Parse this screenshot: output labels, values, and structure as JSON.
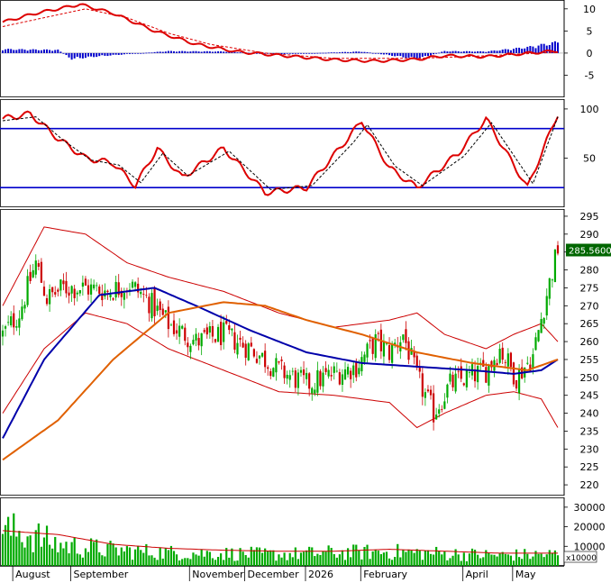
{
  "chart_data": [
    {
      "type": "line",
      "panel": "macd",
      "ylim": [
        -10,
        12
      ],
      "yticks": [
        "10",
        "5",
        "0",
        "-5"
      ],
      "ytick_values": [
        10,
        5,
        0,
        -5
      ],
      "x_count": 202,
      "series": [
        {
          "role": "macd",
          "color": "#dd0000",
          "style": "solid",
          "points": [
            [
              0,
              7
            ],
            [
              12,
              9
            ],
            [
              28,
              11
            ],
            [
              40,
              9
            ],
            [
              55,
              5
            ],
            [
              70,
              2
            ],
            [
              85,
              0.3
            ],
            [
              100,
              -0.5
            ],
            [
              110,
              -1
            ],
            [
              120,
              -1.5
            ],
            [
              135,
              -1.8
            ],
            [
              150,
              -1.4
            ],
            [
              160,
              -0.6
            ],
            [
              175,
              -0.8
            ],
            [
              185,
              -0.3
            ],
            [
              201,
              0.5
            ]
          ]
        },
        {
          "role": "signal",
          "color": "#dd0000",
          "style": "dashed",
          "points": [
            [
              0,
              6
            ],
            [
              15,
              8
            ],
            [
              30,
              10
            ],
            [
              45,
              8
            ],
            [
              60,
              4.5
            ],
            [
              75,
              2
            ],
            [
              95,
              0
            ],
            [
              120,
              -1.2
            ],
            [
              150,
              -1.2
            ],
            [
              175,
              -0.6
            ],
            [
              201,
              0.2
            ]
          ]
        },
        {
          "role": "histogram",
          "color": "#0000cc",
          "type": "bar",
          "points": [
            [
              0,
              1
            ],
            [
              20,
              0.8
            ],
            [
              25,
              -1.5
            ],
            [
              35,
              -0.8
            ],
            [
              60,
              0.5
            ],
            [
              80,
              0.4
            ],
            [
              100,
              -0.3
            ],
            [
              130,
              0.4
            ],
            [
              150,
              -1.5
            ],
            [
              160,
              0.5
            ],
            [
              175,
              0.4
            ],
            [
              190,
              1.5
            ],
            [
              201,
              2.8
            ]
          ]
        }
      ]
    },
    {
      "type": "line",
      "panel": "stochastic",
      "ylim": [
        0,
        110
      ],
      "yticks": [
        "100",
        "50"
      ],
      "ytick_values": [
        100,
        50
      ],
      "hlines": [
        80,
        20
      ],
      "hline_color": "#0000cc",
      "series": [
        {
          "role": "k",
          "color": "#dd0000",
          "style": "solid",
          "points": [
            [
              0,
              90
            ],
            [
              10,
              95
            ],
            [
              20,
              70
            ],
            [
              30,
              50
            ],
            [
              40,
              45
            ],
            [
              48,
              22
            ],
            [
              56,
              60
            ],
            [
              65,
              30
            ],
            [
              80,
              60
            ],
            [
              95,
              15
            ],
            [
              110,
              20
            ],
            [
              125,
              70
            ],
            [
              130,
              88
            ],
            [
              140,
              40
            ],
            [
              150,
              20
            ],
            [
              165,
              55
            ],
            [
              175,
              90
            ],
            [
              190,
              20
            ],
            [
              201,
              95
            ]
          ]
        },
        {
          "role": "d",
          "color": "#000000",
          "style": "dashed",
          "points": [
            [
              0,
              88
            ],
            [
              12,
              92
            ],
            [
              22,
              68
            ],
            [
              32,
              48
            ],
            [
              42,
              43
            ],
            [
              50,
              25
            ],
            [
              58,
              55
            ],
            [
              67,
              32
            ],
            [
              82,
              57
            ],
            [
              97,
              18
            ],
            [
              112,
              22
            ],
            [
              127,
              66
            ],
            [
              132,
              84
            ],
            [
              142,
              42
            ],
            [
              152,
              22
            ],
            [
              167,
              52
            ],
            [
              177,
              86
            ],
            [
              192,
              24
            ],
            [
              201,
              92
            ]
          ]
        }
      ]
    },
    {
      "type": "line",
      "panel": "price",
      "ylim": [
        217,
        297
      ],
      "yticks": [
        "295",
        "290",
        "285",
        "280",
        "275",
        "270",
        "265",
        "260",
        "255",
        "250",
        "245",
        "240",
        "235",
        "230",
        "225",
        "220"
      ],
      "ytick_values": [
        295,
        290,
        285,
        280,
        275,
        270,
        265,
        260,
        255,
        250,
        245,
        240,
        235,
        230,
        225,
        220
      ],
      "last_price": "285.5600",
      "last_price_value": 285.56,
      "x_count": 202,
      "series": [
        {
          "role": "candles",
          "color_up": "#00aa00",
          "color_down": "#cc0000",
          "close_path": [
            [
              0,
              262
            ],
            [
              6,
              268
            ],
            [
              12,
              282
            ],
            [
              16,
              272
            ],
            [
              22,
              275
            ],
            [
              30,
              275
            ],
            [
              38,
              274
            ],
            [
              46,
              276
            ],
            [
              52,
              272
            ],
            [
              60,
              265
            ],
            [
              70,
              260
            ],
            [
              80,
              262
            ],
            [
              90,
              258
            ],
            [
              100,
              252
            ],
            [
              110,
              248
            ],
            [
              120,
              251
            ],
            [
              128,
              253
            ],
            [
              135,
              260
            ],
            [
              140,
              257
            ],
            [
              145,
              262
            ],
            [
              150,
              250
            ],
            [
              156,
              240
            ],
            [
              162,
              248
            ],
            [
              168,
              250
            ],
            [
              175,
              252
            ],
            [
              180,
              258
            ],
            [
              186,
              250
            ],
            [
              192,
              256
            ],
            [
              196,
              270
            ],
            [
              201,
              286
            ]
          ]
        },
        {
          "role": "ma-blue",
          "color": "#0000aa",
          "points": [
            [
              0,
              233
            ],
            [
              15,
              255
            ],
            [
              35,
              273
            ],
            [
              55,
              275
            ],
            [
              70,
              270
            ],
            [
              90,
              263
            ],
            [
              110,
              257
            ],
            [
              130,
              254
            ],
            [
              150,
              253
            ],
            [
              170,
              252
            ],
            [
              185,
              251
            ],
            [
              195,
              252
            ],
            [
              201,
              255
            ]
          ]
        },
        {
          "role": "ma-orange",
          "color": "#e06000",
          "points": [
            [
              0,
              227
            ],
            [
              20,
              238
            ],
            [
              40,
              255
            ],
            [
              60,
              268
            ],
            [
              80,
              271
            ],
            [
              95,
              270
            ],
            [
              110,
              266
            ],
            [
              130,
              262
            ],
            [
              150,
              257
            ],
            [
              170,
              254
            ],
            [
              190,
              252
            ],
            [
              201,
              255
            ]
          ]
        },
        {
          "role": "band-upper",
          "color": "#cc0000",
          "points": [
            [
              0,
              270
            ],
            [
              15,
              292
            ],
            [
              30,
              290
            ],
            [
              45,
              282
            ],
            [
              60,
              278
            ],
            [
              80,
              274
            ],
            [
              100,
              268
            ],
            [
              120,
              264
            ],
            [
              140,
              266
            ],
            [
              150,
              268
            ],
            [
              160,
              262
            ],
            [
              175,
              258
            ],
            [
              185,
              262
            ],
            [
              195,
              265
            ],
            [
              201,
              260
            ]
          ]
        },
        {
          "role": "band-lower",
          "color": "#cc0000",
          "points": [
            [
              0,
              240
            ],
            [
              15,
              258
            ],
            [
              30,
              268
            ],
            [
              45,
              265
            ],
            [
              60,
              258
            ],
            [
              80,
              252
            ],
            [
              100,
              246
            ],
            [
              120,
              245
            ],
            [
              140,
              243
            ],
            [
              150,
              236
            ],
            [
              160,
              240
            ],
            [
              175,
              245
            ],
            [
              185,
              246
            ],
            [
              195,
              244
            ],
            [
              201,
              236
            ]
          ]
        }
      ]
    },
    {
      "type": "bar",
      "panel": "volume",
      "ylim": [
        0,
        35000
      ],
      "yticks": [
        "30000",
        "20000",
        "10000"
      ],
      "ytick_values": [
        30000,
        20000,
        10000
      ],
      "unit_label": "x10000",
      "bar_color": "#00aa00",
      "avg_color": "#cc0000",
      "volume_profile": [
        [
          0,
          20000
        ],
        [
          10,
          18000
        ],
        [
          20,
          12000
        ],
        [
          40,
          9000
        ],
        [
          60,
          7500
        ],
        [
          80,
          7000
        ],
        [
          100,
          6500
        ],
        [
          120,
          7500
        ],
        [
          140,
          8000
        ],
        [
          160,
          7000
        ],
        [
          180,
          6000
        ],
        [
          201,
          6500
        ]
      ],
      "avg_points": [
        [
          0,
          18000
        ],
        [
          20,
          16000
        ],
        [
          40,
          11000
        ],
        [
          60,
          9000
        ],
        [
          80,
          8000
        ],
        [
          100,
          7500
        ],
        [
          120,
          7500
        ],
        [
          140,
          8500
        ],
        [
          160,
          7500
        ],
        [
          180,
          6500
        ],
        [
          201,
          6500
        ]
      ]
    }
  ],
  "x_axis": {
    "labels": [
      {
        "text": "August",
        "index": 2
      },
      {
        "text": "September",
        "index": 23
      },
      {
        "text": "November",
        "index": 66
      },
      {
        "text": "December",
        "index": 86
      },
      {
        "text": "2026",
        "index": 108
      },
      {
        "text": "February",
        "index": 128
      },
      {
        "text": "April",
        "index": 165
      },
      {
        "text": "May",
        "index": 183
      }
    ]
  }
}
